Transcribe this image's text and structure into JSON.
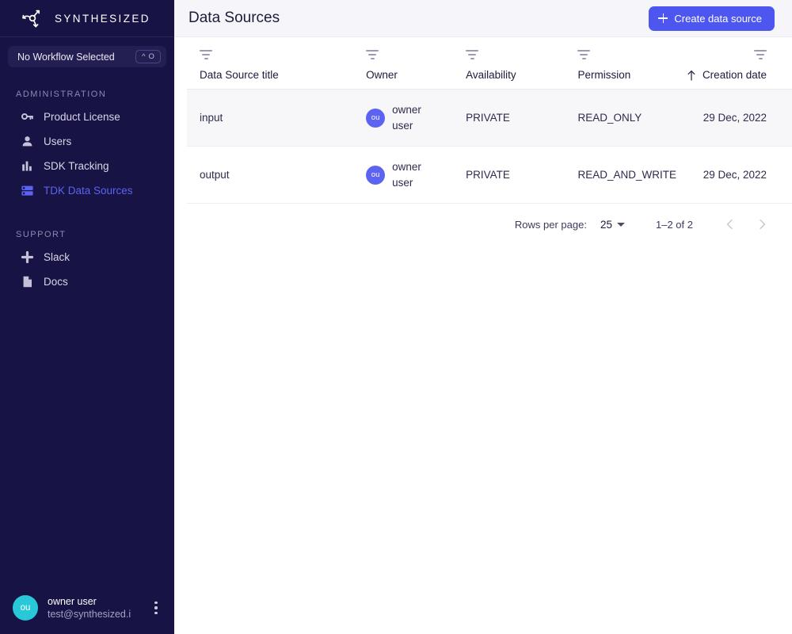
{
  "sidebar": {
    "brand": {
      "name": "SYNTHESIZED",
      "logo_icon": "synthesized-logo-icon"
    },
    "workflow": {
      "label": "No Workflow Selected",
      "shortcut_modifier": "^",
      "shortcut_key": "O"
    },
    "sections": [
      {
        "title": "ADMINISTRATION",
        "items": [
          {
            "label": "Product License",
            "icon": "key-icon",
            "active": false
          },
          {
            "label": "Users",
            "icon": "person-icon",
            "active": false
          },
          {
            "label": "SDK Tracking",
            "icon": "bar-chart-icon",
            "active": false
          },
          {
            "label": "TDK Data Sources",
            "icon": "database-rack-icon",
            "active": true
          }
        ]
      },
      {
        "title": "SUPPORT",
        "items": [
          {
            "label": "Slack",
            "icon": "slack-icon",
            "active": false
          },
          {
            "label": "Docs",
            "icon": "document-icon",
            "active": false
          }
        ]
      }
    ],
    "user": {
      "initials": "ou",
      "name": "owner user",
      "email": "test@synthesized.i",
      "menu_icon": "kebab-menu-icon"
    }
  },
  "header": {
    "title": "Data Sources",
    "create_button": {
      "label": "Create data source",
      "icon": "plus-icon"
    }
  },
  "table": {
    "columns": [
      {
        "key": "title",
        "label": "Data Source title",
        "filter_icon": "filter-icon",
        "align": "left",
        "sorted": false
      },
      {
        "key": "owner",
        "label": "Owner",
        "filter_icon": "filter-icon",
        "align": "left",
        "sorted": false
      },
      {
        "key": "availability",
        "label": "Availability",
        "filter_icon": "filter-icon",
        "align": "left",
        "sorted": false
      },
      {
        "key": "permission",
        "label": "Permission",
        "filter_icon": "filter-icon",
        "align": "left",
        "sorted": false
      },
      {
        "key": "creation_date",
        "label": "Creation date",
        "filter_icon": "filter-icon",
        "align": "right",
        "sorted": true,
        "sort_direction": "asc"
      }
    ],
    "rows": [
      {
        "title": "input",
        "owner_initials": "ou",
        "owner_name": "owner user",
        "availability": "PRIVATE",
        "permission": "READ_ONLY",
        "creation_date": "29 Dec, 2022",
        "hovered": true
      },
      {
        "title": "output",
        "owner_initials": "ou",
        "owner_name": "owner user",
        "availability": "PRIVATE",
        "permission": "READ_AND_WRITE",
        "creation_date": "29 Dec, 2022",
        "hovered": false
      }
    ]
  },
  "pagination": {
    "rows_per_page_label": "Rows per page:",
    "rows_per_page_value": "25",
    "range_label": "1–2 of 2",
    "prev_icon": "chevron-left-icon",
    "next_icon": "chevron-right-icon",
    "prev_enabled": false,
    "next_enabled": false
  },
  "colors": {
    "sidebar_bg": "#171344",
    "accent_blue": "#4d56ef",
    "active_nav": "#5b63f0",
    "avatar_teal": "#28c8d8",
    "row_avatar_blue": "#5b63f0",
    "topbar_bg": "#f6f6fa",
    "row_hover_bg": "#f7f7f9"
  }
}
